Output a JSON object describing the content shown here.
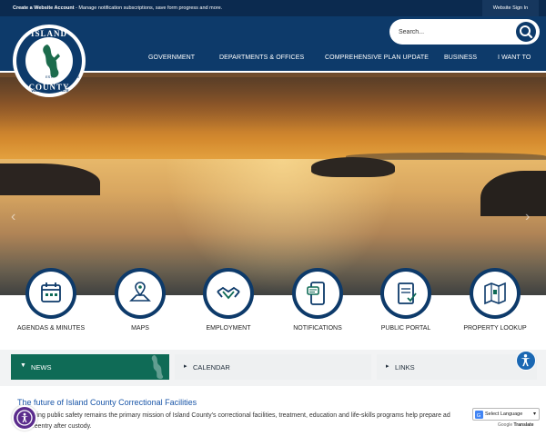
{
  "top_strip": {
    "account_bold": "Create a Website Account",
    "account_text": " - Manage notification subscriptions, save form progress and more.",
    "sign_in": "Website Sign In"
  },
  "search": {
    "placeholder": "Search..."
  },
  "logo": {
    "top": "ISLAND",
    "bottom": "COUNTY",
    "state": "WASHINGTON STATE",
    "est": "EST.",
    "year": "1853"
  },
  "nav": [
    "GOVERNMENT",
    "DEPARTMENTS & OFFICES",
    "COMPREHENSIVE PLAN UPDATE",
    "BUSINESS",
    "I WANT TO"
  ],
  "hero": {
    "prev": "‹",
    "next": "›"
  },
  "quick_links": [
    {
      "label": "AGENDAS & MINUTES",
      "icon": "calendar-icon"
    },
    {
      "label": "MAPS",
      "icon": "map-pin-icon"
    },
    {
      "label": "EMPLOYMENT",
      "icon": "handshake-icon"
    },
    {
      "label": "NOTIFICATIONS",
      "icon": "notification-icon"
    },
    {
      "label": "PUBLIC PORTAL",
      "icon": "document-portal-icon"
    },
    {
      "label": "PROPERTY LOOKUP",
      "icon": "property-map-icon"
    }
  ],
  "tabs": {
    "news": "NEWS",
    "calendar": "CALENDAR",
    "links": "LINKS"
  },
  "news": {
    "title": "The future of Island County Correctional Facilities",
    "body_line1": "protecting public safety remains the primary mission of Island County’s correctional facilities, treatment, education and life-skills programs help prepare ad",
    "body_line2": "ssful reentry after custody."
  },
  "translate": {
    "select": "Select Language",
    "powered_google": "Google",
    "powered_translate": "Translate"
  },
  "colors": {
    "header": "#0d3a6a",
    "news_tab": "#0f6b56",
    "link": "#1a56a8"
  }
}
